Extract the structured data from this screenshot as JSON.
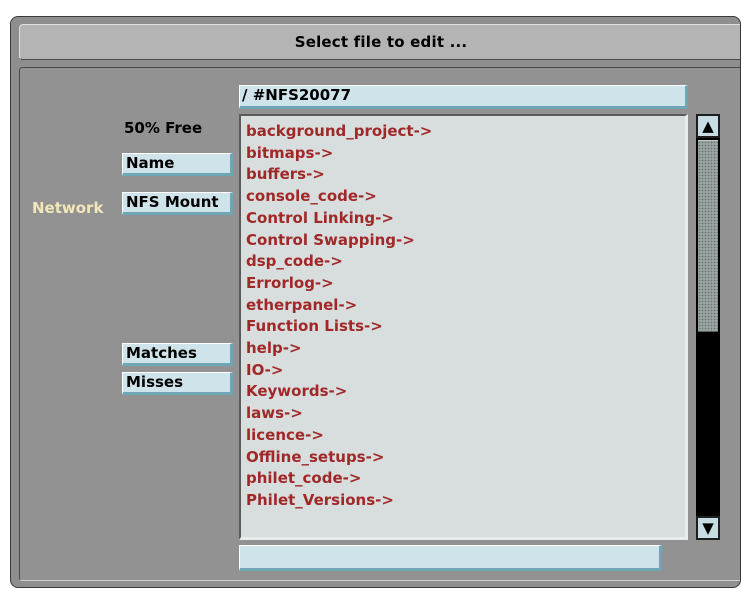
{
  "dialog": {
    "title": "Select file to edit ..."
  },
  "left_panel": {
    "free_space": "50% Free",
    "name_button": "Name",
    "network_label": "Network",
    "nfs_button": "NFS Mount",
    "matches_button": "Matches",
    "misses_button": "Misses"
  },
  "path": {
    "value": "/ #NFS20077"
  },
  "files": [
    "background_project->",
    "bitmaps->",
    "buffers->",
    "console_code->",
    "Control Linking->",
    "Control Swapping->",
    "dsp_code->",
    "Errorlog->",
    "etherpanel->",
    "Function Lists->",
    "help->",
    "IO->",
    "Keywords->",
    "laws->",
    "licence->",
    "Offline_setups->",
    "philet_code->",
    "Philet_Versions->"
  ],
  "icons": {
    "scroll_up": "▲",
    "scroll_down": "▼"
  },
  "colors": {
    "file_text": "#a02828",
    "network_label": "#f1e7ba",
    "field_bg": "#cfe4ea"
  }
}
